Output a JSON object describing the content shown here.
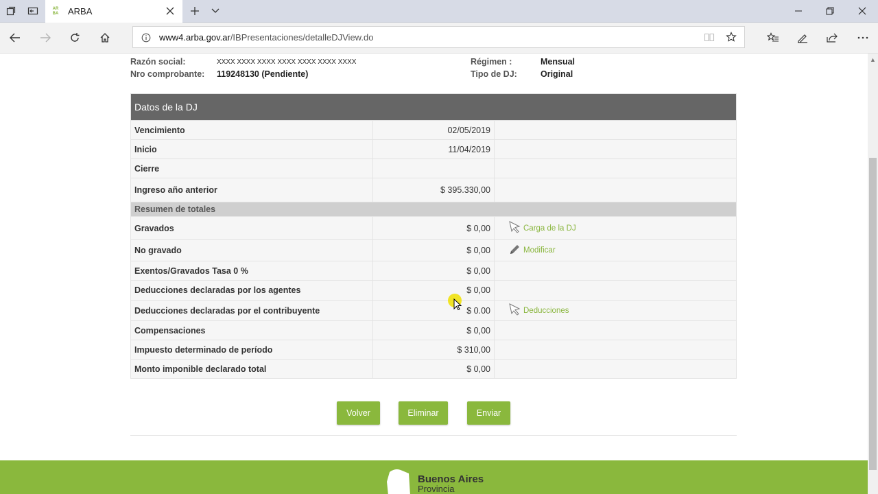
{
  "browser": {
    "tab_title": "ARBA",
    "favicon_text": [
      "AR",
      "BA"
    ],
    "url_host": "www4.arba.gov.ar",
    "url_path": "/IBPresentaciones/detalleDJView.do"
  },
  "header_info": {
    "razon_social_label": "Razón social:",
    "razon_social_value": "XXXX XXXX XXXX XXXX XXXX XXXX XXXX",
    "nro_label": "Nro comprobante:",
    "nro_value": "119248130 (Pendiente)",
    "regimen_label": "Régimen :",
    "regimen_value": "Mensual",
    "tipo_label": "Tipo de DJ:",
    "tipo_value": "Original"
  },
  "table": {
    "title": "Datos de la DJ",
    "rows_top": [
      {
        "label": "Vencimiento",
        "value": "02/05/2019"
      },
      {
        "label": "Inicio",
        "value": "11/04/2019"
      },
      {
        "label": "Cierre",
        "value": ""
      },
      {
        "label": "Ingreso año anterior",
        "value": "$ 395.330,00"
      }
    ],
    "section": "Resumen de totales",
    "rows_bottom": [
      {
        "label": "Gravados",
        "value": "$ 0,00",
        "action": "Carga de la DJ"
      },
      {
        "label": "No gravado",
        "value": "$ 0,00",
        "action": "Modificar"
      },
      {
        "label": "Exentos/Gravados Tasa 0 %",
        "value": "$ 0,00"
      },
      {
        "label": "Deducciones declaradas por los agentes",
        "value": "$ 0,00"
      },
      {
        "label": "Deducciones declaradas por el contribuyente",
        "value": "$ 0.00",
        "action": "Deducciones"
      },
      {
        "label": "Compensaciones",
        "value": "$ 0,00"
      },
      {
        "label": "Impuesto determinado de período",
        "value": "$ 310,00"
      },
      {
        "label": "Monto imponible declarado total",
        "value": "$ 0,00"
      }
    ]
  },
  "buttons": {
    "volver": "Volver",
    "eliminar": "Eliminar",
    "enviar": "Enviar"
  },
  "footer": {
    "name": "Buenos Aires",
    "sub": "Provincia"
  },
  "colors": {
    "accent": "#8ab83d",
    "header_bg": "#666666",
    "section_bg": "#cfcfcf"
  }
}
